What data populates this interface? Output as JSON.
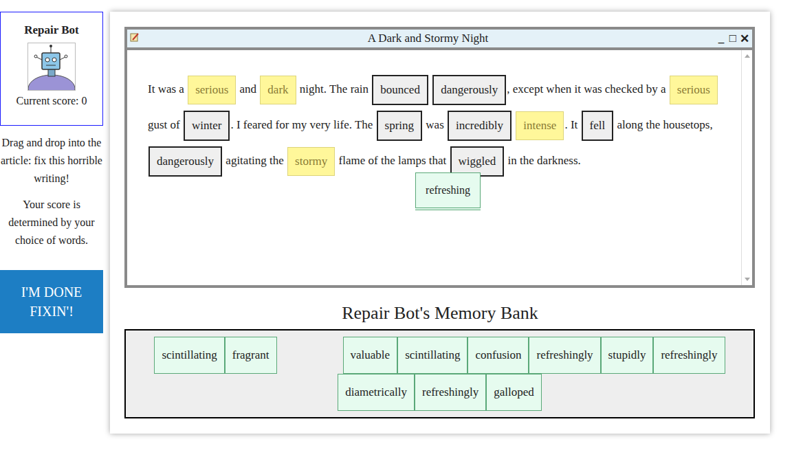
{
  "bot": {
    "title": "Repair Bot",
    "score_label": "Current score:",
    "score": "0"
  },
  "instructions": [
    "Drag and drop into the article: fix this horrible writing!",
    "Your score is determined by your choice of words."
  ],
  "done_button": "I'M DONE FIXIN'!",
  "window": {
    "title": "A Dark and Stormy Night",
    "controls": [
      "_",
      "□",
      "✕"
    ]
  },
  "article": [
    {
      "kind": "text",
      "text": "It was a"
    },
    {
      "kind": "slot",
      "text": "serious",
      "highlighted": true
    },
    {
      "kind": "text",
      "text": "and"
    },
    {
      "kind": "slot",
      "text": "dark",
      "highlighted": true
    },
    {
      "kind": "text",
      "text": "night. The rain"
    },
    {
      "kind": "slot",
      "text": "bounced",
      "highlighted": false
    },
    {
      "kind": "slot",
      "text": "dangerously",
      "highlighted": false
    },
    {
      "kind": "text",
      "text": ", except when it was checked by a"
    },
    {
      "kind": "slot",
      "text": "serious",
      "highlighted": true
    },
    {
      "kind": "text",
      "text": "gust of"
    },
    {
      "kind": "slot",
      "text": "winter",
      "highlighted": false
    },
    {
      "kind": "text",
      "text": ". I feared for my very life. The"
    },
    {
      "kind": "slot",
      "text": "spring",
      "highlighted": false
    },
    {
      "kind": "text",
      "text": "was"
    },
    {
      "kind": "slot",
      "text": "incredibly",
      "highlighted": false
    },
    {
      "kind": "slot",
      "text": "intense",
      "highlighted": true
    },
    {
      "kind": "text",
      "text": ". It"
    },
    {
      "kind": "slot",
      "text": "fell",
      "highlighted": false
    },
    {
      "kind": "text",
      "text": "along the housetops,"
    },
    {
      "kind": "slot",
      "text": "dangerously",
      "highlighted": false
    },
    {
      "kind": "text",
      "text": "agitating the"
    },
    {
      "kind": "slot",
      "text": "stormy",
      "highlighted": true
    },
    {
      "kind": "text",
      "text": "flame of the lamps that"
    },
    {
      "kind": "slot",
      "text": "wiggled",
      "highlighted": false
    },
    {
      "kind": "text",
      "text": "in the darkness."
    }
  ],
  "dragging": {
    "text": "refreshing",
    "dragging": true
  },
  "bank": {
    "title": "Repair Bot's Memory Bank",
    "items": [
      {
        "kind": "word",
        "text": "scintillating"
      },
      {
        "kind": "word",
        "text": "fragrant"
      },
      {
        "kind": "hole"
      },
      {
        "kind": "word",
        "text": "valuable"
      },
      {
        "kind": "word",
        "text": "scintillating"
      },
      {
        "kind": "word",
        "text": "confusion"
      },
      {
        "kind": "word",
        "text": "refreshingly"
      },
      {
        "kind": "word",
        "text": "stupidly"
      },
      {
        "kind": "word",
        "text": "refreshingly"
      },
      {
        "kind": "word",
        "text": "diametrically"
      },
      {
        "kind": "word",
        "text": "refreshingly"
      },
      {
        "kind": "word",
        "text": "galloped"
      }
    ]
  }
}
